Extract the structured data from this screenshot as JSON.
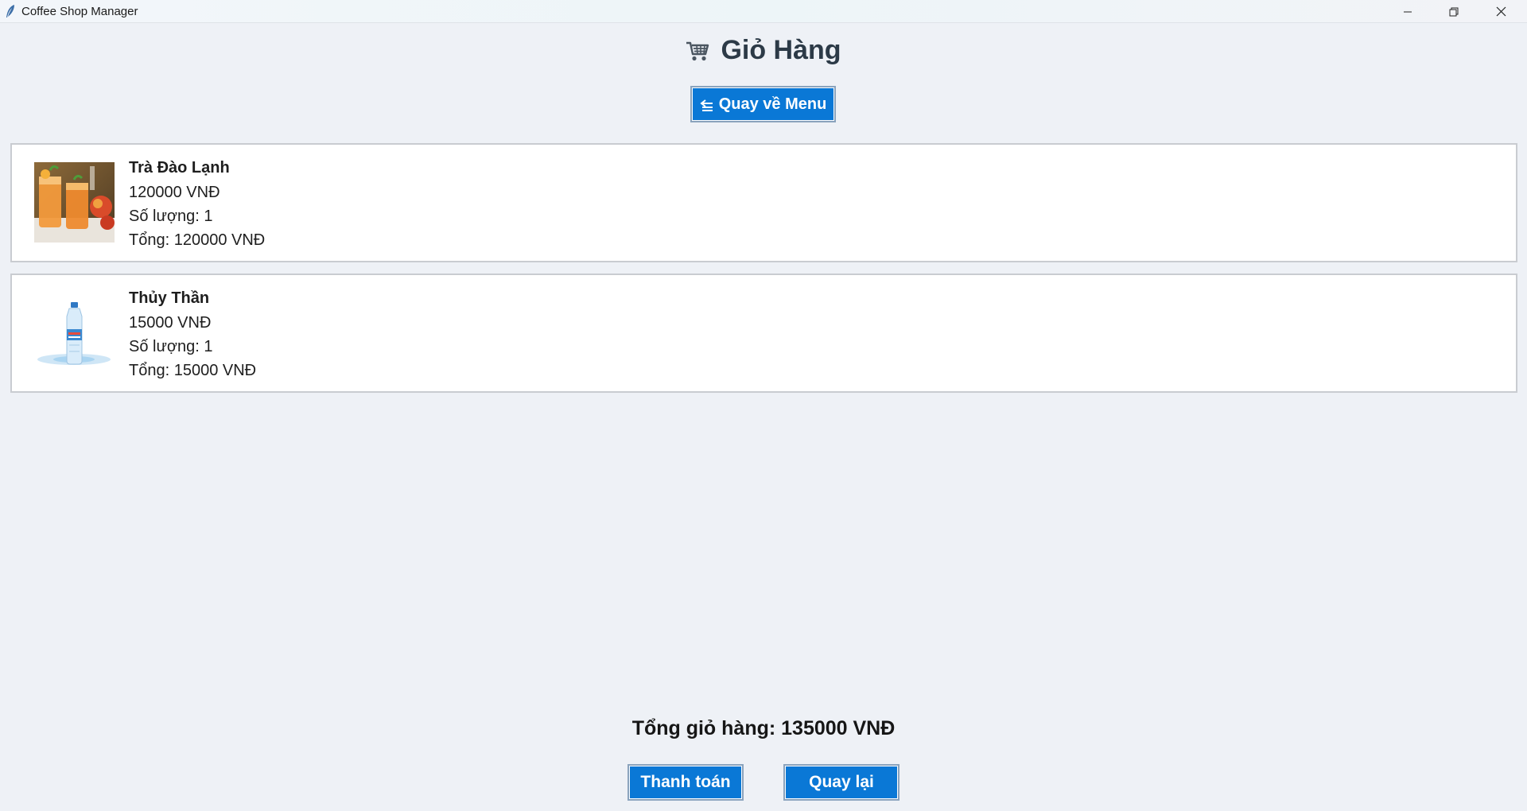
{
  "window": {
    "title": "Coffee Shop Manager",
    "controls": [
      "minimize-icon",
      "restore-icon",
      "close-icon"
    ]
  },
  "header": {
    "icon": "shopping-cart-icon",
    "title": "Giỏ Hàng",
    "back_to_menu_label": "Quay về Menu",
    "back_to_menu_icon": "back-arrow-icon"
  },
  "cart": {
    "items": [
      {
        "name": "Trà Đào Lạnh",
        "price": "120000 VNĐ",
        "quantity": "Số lượng: 1",
        "total": "Tổng: 120000 VNĐ",
        "image": "peach-tea-image"
      },
      {
        "name": "Thủy Thần",
        "price": "15000 VNĐ",
        "quantity": "Số lượng: 1",
        "total": "Tổng: 15000 VNĐ",
        "image": "water-bottle-image"
      }
    ],
    "grand_total": "Tổng giỏ hàng: 135000 VNĐ"
  },
  "actions": {
    "checkout_label": "Thanh toán",
    "back_label": "Quay lại"
  },
  "colors": {
    "accent": "#0a78d6",
    "background": "#eef1f6",
    "card": "#ffffff"
  }
}
